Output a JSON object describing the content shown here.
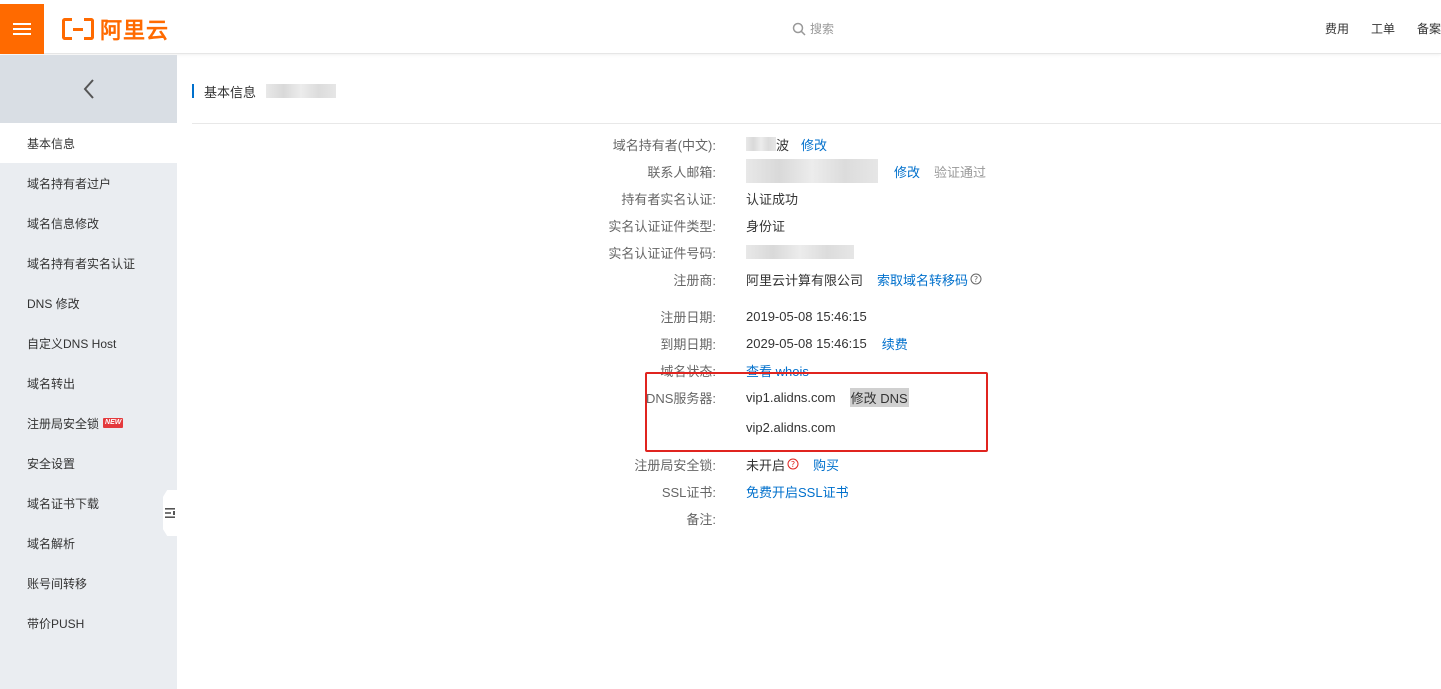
{
  "header": {
    "logo_text": "阿里云",
    "search_placeholder": "搜索",
    "links": [
      "费用",
      "工单",
      "备案"
    ]
  },
  "sidebar": {
    "items": [
      {
        "label": "基本信息",
        "active": true
      },
      {
        "label": "域名持有者过户"
      },
      {
        "label": "域名信息修改"
      },
      {
        "label": "域名持有者实名认证"
      },
      {
        "label": "DNS 修改"
      },
      {
        "label": "自定义DNS Host"
      },
      {
        "label": "域名转出"
      },
      {
        "label": "注册局安全锁",
        "badge": "NEW"
      },
      {
        "label": "安全设置"
      },
      {
        "label": "域名证书下载"
      },
      {
        "label": "域名解析"
      },
      {
        "label": "账号间转移"
      },
      {
        "label": "带价PUSH"
      }
    ]
  },
  "main": {
    "title": "基本信息",
    "fields": {
      "holder_cn": {
        "label": "域名持有者(中文):",
        "value": "波",
        "action": "修改"
      },
      "email": {
        "label": "联系人邮箱:",
        "action": "修改",
        "status": "验证通过"
      },
      "realname": {
        "label": "持有者实名认证:",
        "value": "认证成功"
      },
      "cert_type": {
        "label": "实名认证证件类型:",
        "value": "身份证"
      },
      "cert_no": {
        "label": "实名认证证件号码:"
      },
      "registrar": {
        "label": "注册商:",
        "value": "阿里云计算有限公司",
        "action": "索取域名转移码"
      },
      "reg_date": {
        "label": "注册日期:",
        "value": "2019-05-08 15:46:15"
      },
      "exp_date": {
        "label": "到期日期:",
        "value": "2029-05-08 15:46:15",
        "action": "续费"
      },
      "status": {
        "label": "域名状态:",
        "action": "查看 whois"
      },
      "dns": {
        "label": "DNS服务器:",
        "value1": "vip1.alidns.com",
        "value2": "vip2.alidns.com",
        "action": "修改 DNS"
      },
      "lock": {
        "label": "注册局安全锁:",
        "value": "未开启",
        "action": "购买"
      },
      "ssl": {
        "label": "SSL证书:",
        "action": "免费开启SSL证书"
      },
      "note": {
        "label": "备注:"
      }
    }
  },
  "colors": {
    "brand": "#ff6a00",
    "link": "#0070cc",
    "highlight_border": "#e0241f"
  }
}
